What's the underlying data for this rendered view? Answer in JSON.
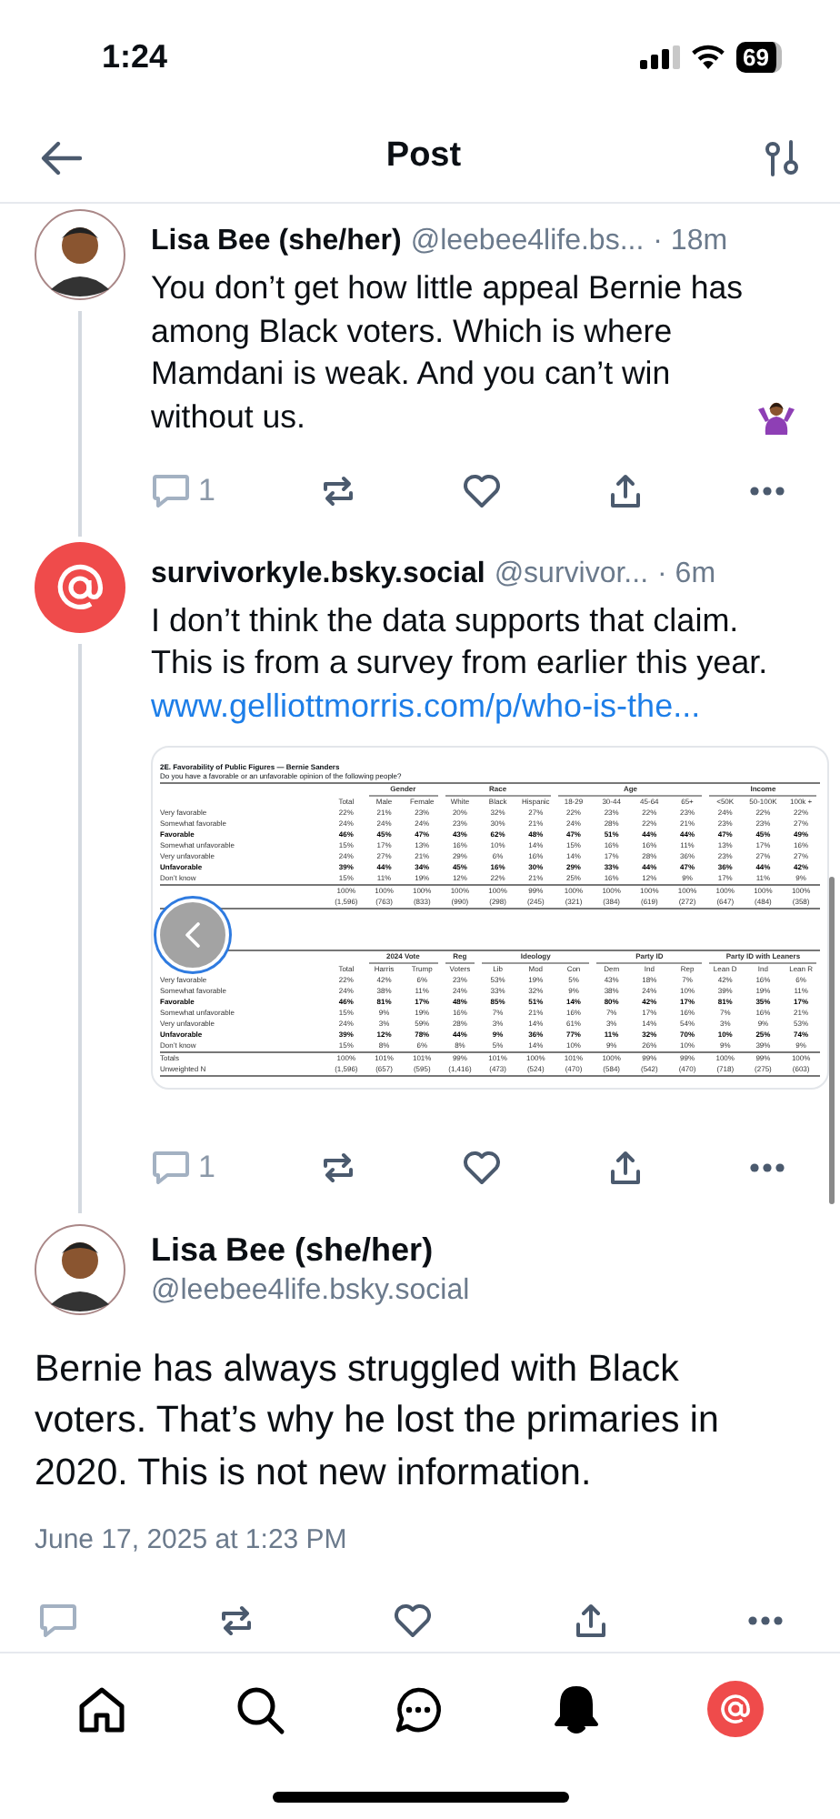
{
  "status_bar": {
    "time": "1:24",
    "battery": "69"
  },
  "header": {
    "title": "Post"
  },
  "posts": [
    {
      "kind": "reply",
      "avatar": {
        "kind": "person"
      },
      "author": "Lisa Bee (she/her)",
      "handle": "@leebee4life.bs...",
      "age": "· 18m",
      "text": "You don’t get how little appeal Bernie has among Black voters. Which is where Mamdani is weak. And you can’t win without us.",
      "text_icon": {
        "kind": "shrug"
      },
      "reply_count": "1"
    },
    {
      "kind": "reply",
      "avatar": {
        "kind": "at"
      },
      "author": "survivorkyle.bsky.social",
      "handle": "@survivor...",
      "age": "· 6m",
      "text": "I don’t think the data supports that claim. This is from a survey from earlier this year.",
      "link": "www.gelliottmorris.com/p/who-is-the...",
      "reply_count": "1",
      "embed": {
        "kind": "document",
        "title": "2E. Favorability of Public Figures — Bernie Sanders",
        "subtitle": "Do you have a favorable or an unfavorable opinion of the following people?",
        "tables": [
          {
            "column_groups": [
              {
                "columns": [
                  "Total"
                ]
              },
              {
                "label": "Gender",
                "columns": [
                  "Male",
                  "Female"
                ]
              },
              {
                "label": "Race",
                "columns": [
                  "White",
                  "Black",
                  "Hispanic"
                ]
              },
              {
                "label": "Age",
                "columns": [
                  "18-29",
                  "30-44",
                  "45-64",
                  "65+"
                ]
              },
              {
                "label": "Income",
                "columns": [
                  "<50K",
                  "50-100K",
                  "100k +"
                ]
              }
            ],
            "rows": [
              {
                "kind": "item",
                "label": "Very favorable",
                "values": [
                  "22%",
                  "21%",
                  "23%",
                  "20%",
                  "32%",
                  "27%",
                  "22%",
                  "23%",
                  "22%",
                  "23%",
                  "24%",
                  "22%",
                  "22%"
                ]
              },
              {
                "kind": "item",
                "label": "Somewhat favorable",
                "values": [
                  "24%",
                  "24%",
                  "24%",
                  "23%",
                  "30%",
                  "21%",
                  "24%",
                  "28%",
                  "22%",
                  "21%",
                  "23%",
                  "23%",
                  "27%"
                ]
              },
              {
                "kind": "net",
                "label": "Favorable",
                "values": [
                  "46%",
                  "45%",
                  "47%",
                  "43%",
                  "62%",
                  "48%",
                  "47%",
                  "51%",
                  "44%",
                  "44%",
                  "47%",
                  "45%",
                  "49%"
                ]
              },
              {
                "kind": "item",
                "label": "Somewhat unfavorable",
                "values": [
                  "15%",
                  "17%",
                  "13%",
                  "16%",
                  "10%",
                  "14%",
                  "15%",
                  "16%",
                  "16%",
                  "11%",
                  "13%",
                  "17%",
                  "16%"
                ]
              },
              {
                "kind": "item",
                "label": "Very unfavorable",
                "values": [
                  "24%",
                  "27%",
                  "21%",
                  "29%",
                  "6%",
                  "16%",
                  "14%",
                  "17%",
                  "28%",
                  "36%",
                  "23%",
                  "27%",
                  "27%"
                ]
              },
              {
                "kind": "net",
                "label": "Unfavorable",
                "values": [
                  "39%",
                  "44%",
                  "34%",
                  "45%",
                  "16%",
                  "30%",
                  "29%",
                  "33%",
                  "44%",
                  "47%",
                  "36%",
                  "44%",
                  "42%"
                ]
              },
              {
                "kind": "item",
                "label": "Don’t know",
                "values": [
                  "15%",
                  "11%",
                  "19%",
                  "12%",
                  "22%",
                  "21%",
                  "25%",
                  "16%",
                  "12%",
                  "9%",
                  "17%",
                  "11%",
                  "9%"
                ]
              },
              {
                "kind": "total",
                "values": [
                  "100%",
                  "100%",
                  "100%",
                  "100%",
                  "100%",
                  "99%",
                  "100%",
                  "100%",
                  "100%",
                  "100%",
                  "100%",
                  "100%",
                  "100%"
                ]
              },
              {
                "kind": "count",
                "values": [
                  "(1,596)",
                  "(763)",
                  "(833)",
                  "(990)",
                  "(298)",
                  "(245)",
                  "(321)",
                  "(384)",
                  "(619)",
                  "(272)",
                  "(647)",
                  "(484)",
                  "(358)"
                ]
              }
            ]
          },
          {
            "column_groups": [
              {
                "columns": [
                  "Total"
                ]
              },
              {
                "label": "2024 Vote",
                "columns": [
                  "Harris",
                  "Trump"
                ]
              },
              {
                "label": "Reg",
                "columns": [
                  "Voters"
                ]
              },
              {
                "label": "Ideology",
                "columns": [
                  "Lib",
                  "Mod",
                  "Con"
                ]
              },
              {
                "label": "Party ID",
                "columns": [
                  "Dem",
                  "Ind",
                  "Rep"
                ]
              },
              {
                "label": "Party ID with Leaners",
                "columns": [
                  "Lean D",
                  "Ind",
                  "Lean R"
                ]
              }
            ],
            "rows": [
              {
                "kind": "item",
                "label": "Very favorable",
                "values": [
                  "22%",
                  "42%",
                  "6%",
                  "23%",
                  "53%",
                  "19%",
                  "5%",
                  "43%",
                  "18%",
                  "7%",
                  "42%",
                  "16%",
                  "6%"
                ]
              },
              {
                "kind": "item",
                "label": "Somewhat favorable",
                "values": [
                  "24%",
                  "38%",
                  "11%",
                  "24%",
                  "33%",
                  "32%",
                  "9%",
                  "38%",
                  "24%",
                  "10%",
                  "39%",
                  "19%",
                  "11%"
                ]
              },
              {
                "kind": "net",
                "label": "Favorable",
                "values": [
                  "46%",
                  "81%",
                  "17%",
                  "48%",
                  "85%",
                  "51%",
                  "14%",
                  "80%",
                  "42%",
                  "17%",
                  "81%",
                  "35%",
                  "17%"
                ]
              },
              {
                "kind": "item",
                "label": "Somewhat unfavorable",
                "values": [
                  "15%",
                  "9%",
                  "19%",
                  "16%",
                  "7%",
                  "21%",
                  "16%",
                  "7%",
                  "17%",
                  "16%",
                  "7%",
                  "16%",
                  "21%"
                ]
              },
              {
                "kind": "item",
                "label": "Very unfavorable",
                "values": [
                  "24%",
                  "3%",
                  "59%",
                  "28%",
                  "3%",
                  "14%",
                  "61%",
                  "3%",
                  "14%",
                  "54%",
                  "3%",
                  "9%",
                  "53%"
                ]
              },
              {
                "kind": "net",
                "label": "Unfavorable",
                "values": [
                  "39%",
                  "12%",
                  "78%",
                  "44%",
                  "9%",
                  "36%",
                  "77%",
                  "11%",
                  "32%",
                  "70%",
                  "10%",
                  "25%",
                  "74%"
                ]
              },
              {
                "kind": "item",
                "label": "Don’t know",
                "values": [
                  "15%",
                  "8%",
                  "6%",
                  "8%",
                  "5%",
                  "14%",
                  "10%",
                  "9%",
                  "26%",
                  "10%",
                  "9%",
                  "39%",
                  "9%"
                ]
              },
              {
                "kind": "total",
                "label": "Totals",
                "values": [
                  "100%",
                  "101%",
                  "101%",
                  "99%",
                  "101%",
                  "100%",
                  "101%",
                  "100%",
                  "99%",
                  "99%",
                  "100%",
                  "99%",
                  "100%"
                ]
              },
              {
                "kind": "count",
                "label": "Unweighted N",
                "values": [
                  "(1,596)",
                  "(657)",
                  "(595)",
                  "(1,416)",
                  "(473)",
                  "(524)",
                  "(470)",
                  "(584)",
                  "(542)",
                  "(470)",
                  "(718)",
                  "(275)",
                  "(603)"
                ]
              }
            ]
          }
        ]
      }
    },
    {
      "kind": "focused",
      "avatar": {
        "kind": "person"
      },
      "author": "Lisa Bee (she/her)",
      "handle": "@leebee4life.bsky.social",
      "text": "Bernie has always struggled with Black voters. That’s why he lost the primaries in 2020. This is not new information.",
      "date": "June 17, 2025 at 1:23 PM"
    }
  ],
  "tabs": [
    {
      "kind": "home",
      "selected": false
    },
    {
      "kind": "search",
      "selected": false
    },
    {
      "kind": "chat",
      "selected": false
    },
    {
      "kind": "bell",
      "selected": true
    },
    {
      "kind": "profile",
      "selected": false
    }
  ]
}
